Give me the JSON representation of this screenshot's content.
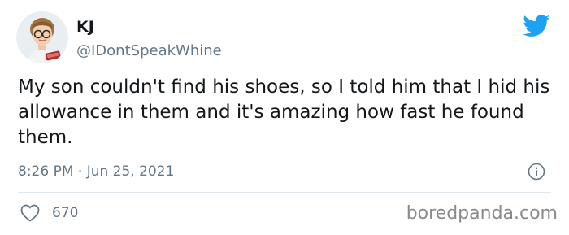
{
  "tweet": {
    "display_name": "KJ",
    "handle": "@IDontSpeakWhine",
    "text": "My son couldn't find his shoes, so I told him that I hid his allowance in them and it's amazing how fast he found them.",
    "timestamp": "8:26 PM · Jun 25, 2021",
    "like_count": "670"
  },
  "icons": {
    "avatar": "avatar-bitmoji",
    "brand": "twitter-bird-icon",
    "info": "info-icon",
    "like": "heart-icon"
  },
  "colors": {
    "twitter_blue": "#1da1f2",
    "muted_text": "#657786",
    "primary_text": "#14171a",
    "divider": "#e1e8ed"
  },
  "watermark": "boredpanda.com"
}
